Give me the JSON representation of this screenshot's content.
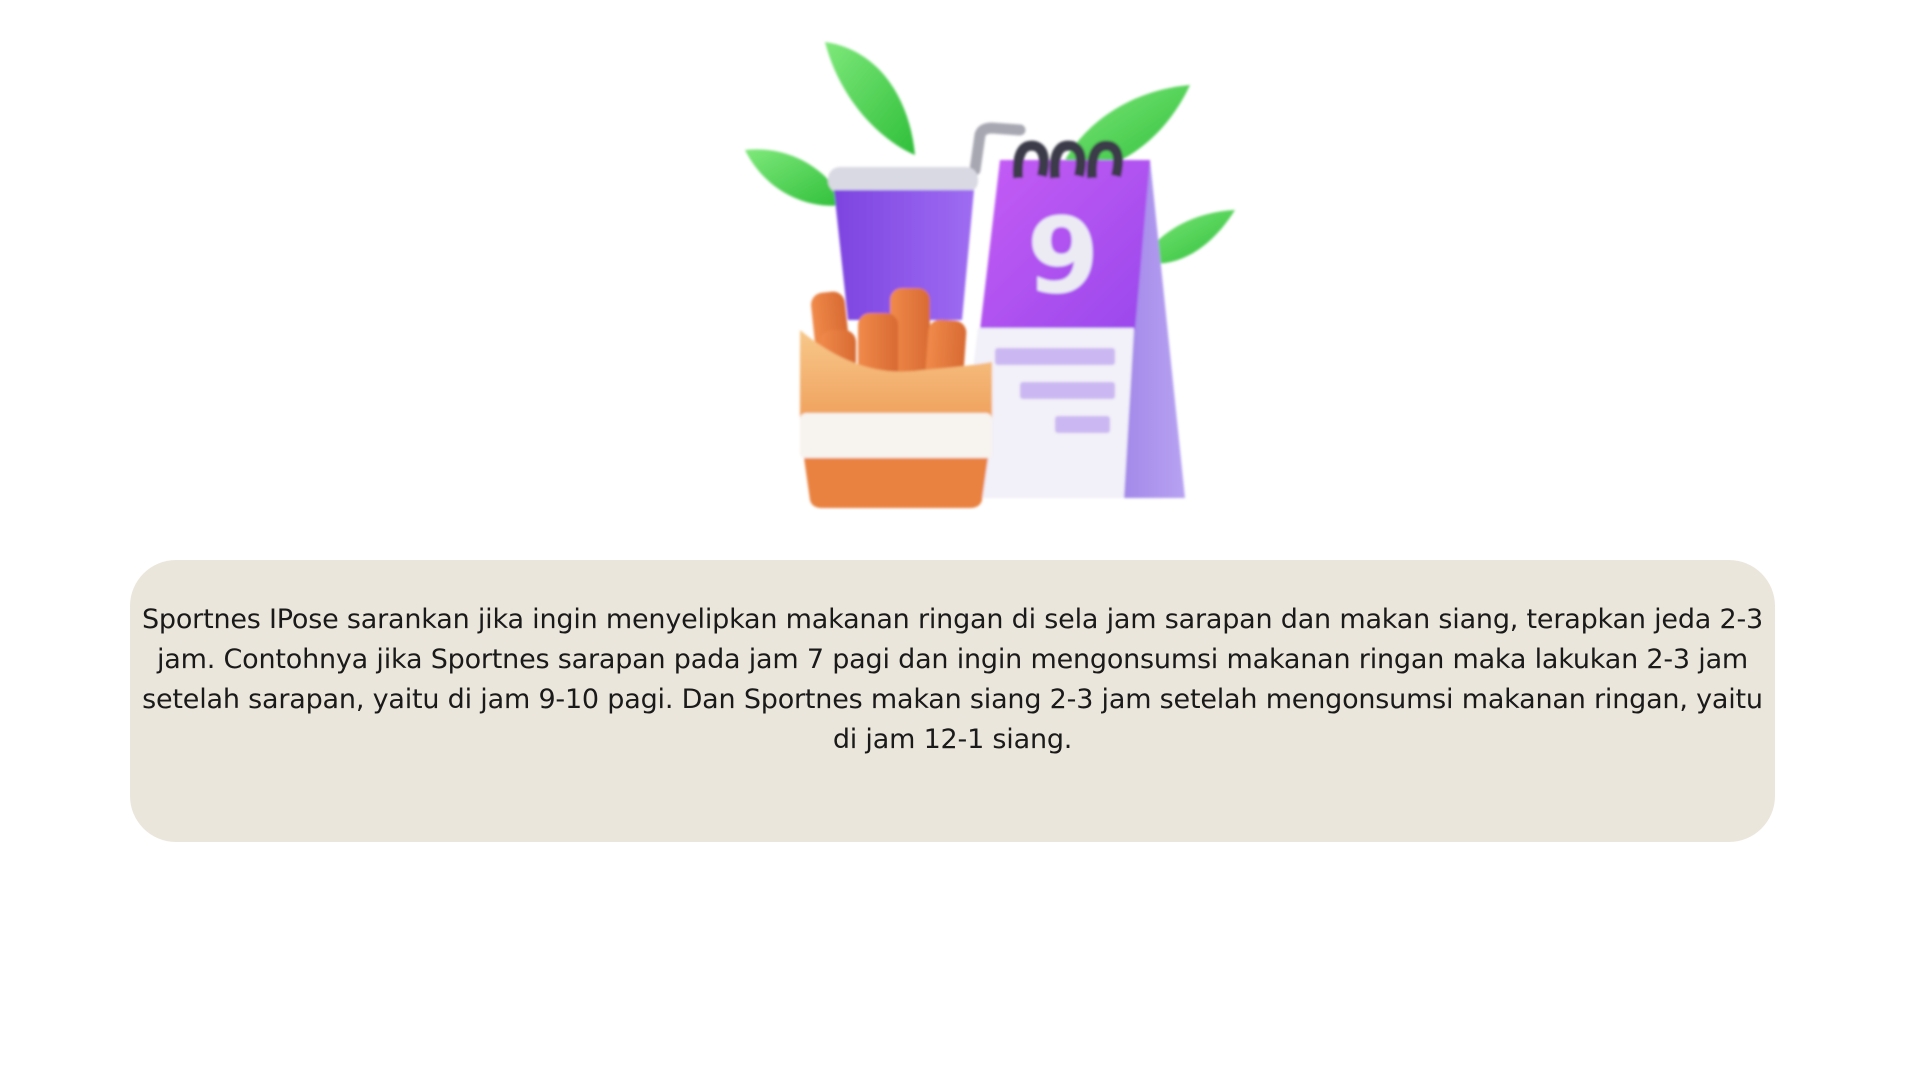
{
  "illustration": {
    "icon": "food-calendar-schedule-illustration",
    "calendar_day": "9",
    "colors": {
      "leaf": "#4cd44f",
      "cup": "#8a4fe6",
      "calendar": "#b34ff0",
      "tray": "#f0a25c",
      "fries": "#e8783c"
    }
  },
  "card": {
    "background": "#ebe6dc",
    "text": "Sportnes IPose sarankan jika ingin menyelipkan makanan ringan di sela jam sarapan dan makan siang, terapkan jeda 2-3 jam. Contohnya jika Sportnes sarapan pada jam 7 pagi dan ingin mengonsumsi makanan ringan maka lakukan 2-3 jam setelah sarapan, yaitu di jam 9-10 pagi. Dan Sportnes makan siang 2-3 jam setelah mengonsumsi makanan ringan, yaitu di jam 12-1 siang."
  }
}
